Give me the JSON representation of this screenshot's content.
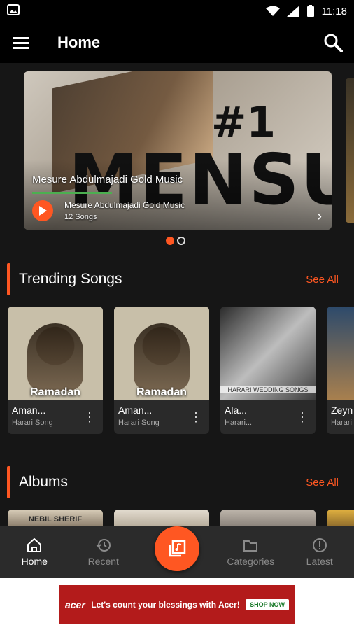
{
  "status_bar": {
    "time": "11:18",
    "icons": [
      "image-icon",
      "wifi-icon",
      "signal-icon",
      "battery-icon"
    ]
  },
  "app_bar": {
    "title": "Home",
    "menu_icon": "hamburger-menu-icon",
    "search_icon": "search-icon"
  },
  "banner": {
    "title": "Mesure Abdulmajadi Gold Music",
    "subtitle": "Mesure Abdulmajadi Gold Music",
    "count": "12 Songs",
    "art_hash": "#1",
    "art_name": "MENSUR",
    "progress": 0.26,
    "active_slide": 1,
    "total_slides": 2
  },
  "trending": {
    "heading": "Trending Songs",
    "see_all": "See All",
    "items": [
      {
        "name": "Aman...",
        "category": "Harari Song",
        "overlay": "Ramadan"
      },
      {
        "name": "Aman...",
        "category": "Harari Song",
        "overlay": "Ramadan"
      },
      {
        "name": "Ala...",
        "category": "Harari...",
        "overlay": "HARARI WEDDING SONGS"
      },
      {
        "name": "Zeyn",
        "category": "Harari",
        "overlay": ""
      }
    ]
  },
  "albums": {
    "heading": "Albums",
    "see_all": "See All",
    "first_album_label": "NEBIL SHERIF"
  },
  "bottom_nav": {
    "items": [
      {
        "label": "Home",
        "icon": "home-icon",
        "active": true
      },
      {
        "label": "Recent",
        "icon": "history-icon",
        "active": false
      },
      {
        "label": "Categories",
        "icon": "folder-icon",
        "active": false
      },
      {
        "label": "Latest",
        "icon": "alert-icon",
        "active": false
      }
    ],
    "fab_icon": "music-library-icon"
  },
  "ad": {
    "brand": "acer",
    "headline": "Let's count your blessings with Acer!",
    "cta": "SHOP NOW",
    "accent": "#b31b1b"
  },
  "colors": {
    "accent": "#ff5722",
    "background": "#161616",
    "card": "#2a2a2a"
  }
}
